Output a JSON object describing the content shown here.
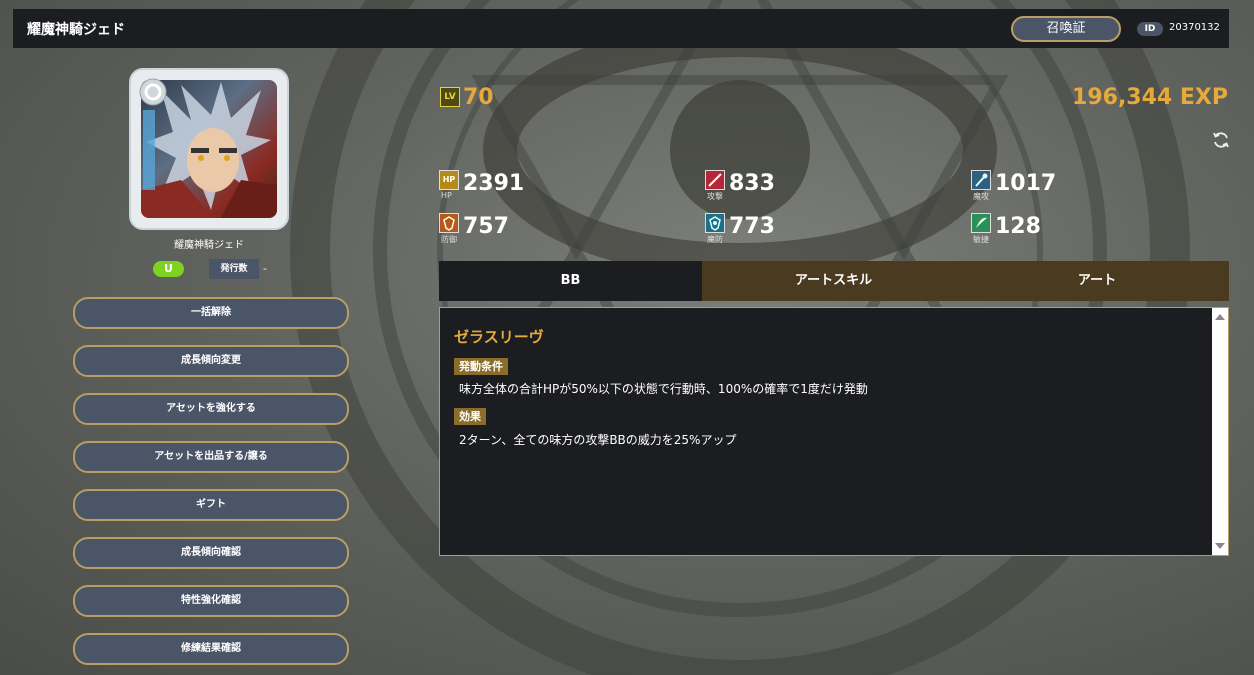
{
  "header": {
    "title": "耀魔神騎ジェド",
    "summon_button": "召喚証",
    "id_label": "ID",
    "id_value": "20370132"
  },
  "unit": {
    "name": "耀魔神騎ジェド",
    "rarity": "U",
    "issue_label": "発行数",
    "issue_value": "-"
  },
  "actions": [
    "一括解除",
    "成長傾向変更",
    "アセットを強化する",
    "アセットを出品する/譲る",
    "ギフト",
    "成長傾向確認",
    "特性強化確認",
    "修練結果確認"
  ],
  "level": {
    "icon_text": "LV",
    "value": "70"
  },
  "exp": "196,344 EXP",
  "stats": [
    {
      "icon": "hp-icon",
      "icon_text": "HP",
      "label": "HP",
      "value": "2391",
      "color": "#b58a1c"
    },
    {
      "icon": "attack-icon",
      "icon_text": "",
      "label": "攻撃",
      "value": "833",
      "color": "#b5263a"
    },
    {
      "icon": "magic-attack-icon",
      "icon_text": "",
      "label": "魔攻",
      "value": "1017",
      "color": "#2f5f7f"
    },
    {
      "icon": "defense-icon",
      "icon_text": "",
      "label": "防御",
      "value": "757",
      "color": "#b55a1c"
    },
    {
      "icon": "magic-defense-icon",
      "icon_text": "",
      "label": "魔防",
      "value": "773",
      "color": "#1f6f88"
    },
    {
      "icon": "agility-icon",
      "icon_text": "",
      "label": "敏捷",
      "value": "128",
      "color": "#2a8f5a"
    }
  ],
  "tabs": [
    "BB",
    "アートスキル",
    "アート"
  ],
  "skill": {
    "name": "ゼラスリーヴ",
    "condition_label": "発動条件",
    "condition_text": "味方全体の合計HPが50%以下の状態で行動時、100%の確率で1度だけ発動",
    "effect_label": "効果",
    "effect_text": "2ターン、全ての味方の攻撃BBの威力を25%アップ"
  },
  "colors": {
    "accent": "#e7a93b",
    "button_bg": "#4b5568",
    "button_border": "#b99d62",
    "panel_bg": "#1c1d20"
  }
}
